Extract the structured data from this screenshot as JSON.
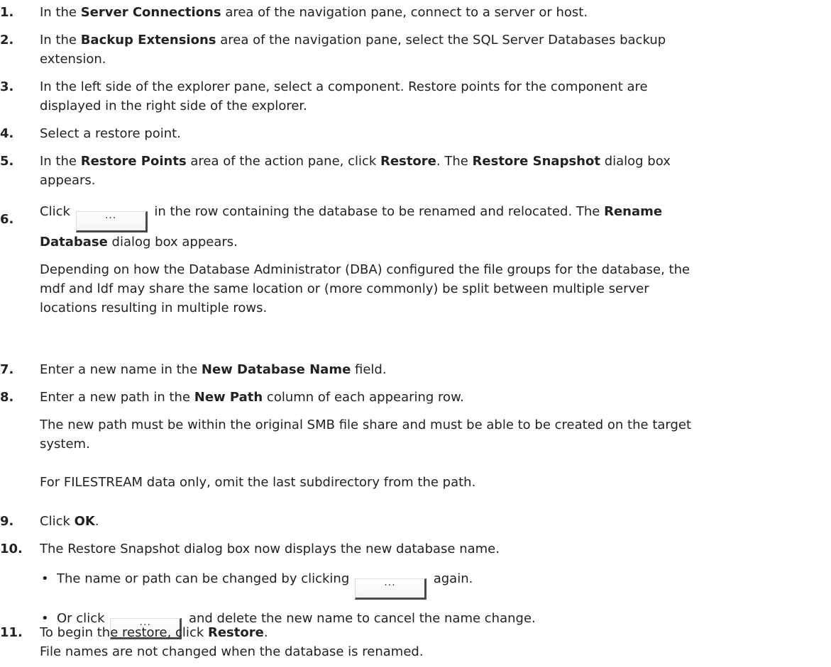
{
  "steps": [
    {
      "num": "1.",
      "a": "In the ",
      "b1": "Server Connections",
      "c": " area of the navigation pane, connect to a server or host."
    },
    {
      "num": "2.",
      "a": "In the ",
      "b1": "Backup Extensions",
      "c": " area of the navigation pane, select the SQL Server Databases backup",
      "d": "extension."
    },
    {
      "num": "3.",
      "a": "In the left side of the explorer pane, select a component. Restore points for the component are",
      "b": "displayed in the right side of the explorer."
    },
    {
      "num": "4.",
      "a": "Select a restore point."
    },
    {
      "num": "5.",
      "a": "In the ",
      "b1": "Restore Points",
      "c": " area of the action pane, click ",
      "b2": "Restore",
      "d": ". The ",
      "b3": "Restore Snapshot",
      "e": " dialog box",
      "f": "appears."
    },
    {
      "num": "6.",
      "a": "Click ",
      "btn": "...",
      "c": " in the row containing the database to be renamed and relocated. The ",
      "b1": "Rename",
      "b2": "Database",
      "d": " dialog box appears.",
      "p1": "Depending on how the Database Administrator (DBA) configured the file groups for the database, the",
      "p2": "mdf and ldf may share the same location or (more commonly) be split between multiple server",
      "p3": "locations resulting in multiple rows."
    },
    {
      "num": "7.",
      "a": "Enter a new name in the ",
      "b1": "New Database Name",
      "c": " field."
    },
    {
      "num": "8.",
      "a": "Enter a new path in the ",
      "b1": "New Path",
      "c": " column of each appearing row.",
      "p1": "The new path must be within the original SMB file share and must be able to be created on the target",
      "p2": "system.",
      "p3": "For FILESTREAM data only, omit the last subdirectory from the path."
    },
    {
      "num": "9.",
      "a": "Click ",
      "b1": "OK",
      "c": "."
    },
    {
      "num": "10.",
      "a": "The Restore Snapshot dialog box now displays the new database name.",
      "bullet_char": "•",
      "bullet1_a": "The name or path can be changed by clicking ",
      "bullet1_btn": "...",
      "bullet1_c": " again.",
      "bullet2_a": "Or click ",
      "bullet2_btn": "...",
      "bullet2_c": " and delete the new name to cancel the name change."
    },
    {
      "num": "11.",
      "a": "To begin the restore, click ",
      "b1": "Restore",
      "c": ".",
      "p1": "File names are not changed when the database is renamed."
    }
  ]
}
